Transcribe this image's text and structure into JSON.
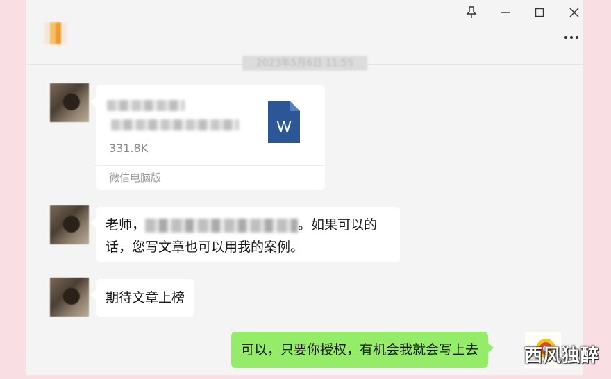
{
  "chat": {
    "timestamp": "2023年5月6日 11:55"
  },
  "messages": {
    "file": {
      "size": "331.8K",
      "source": "微信电脑版",
      "icon_letter": "W"
    },
    "msg2": {
      "prefix": "老师，",
      "suffix_line1": "。如果可以的",
      "line2": "话，您写文章也可以用我的案例。"
    },
    "msg3": {
      "text": "期待文章上榜"
    },
    "msg4": {
      "text": "可以，只要你授权，有机会我就会写上去"
    }
  },
  "watermark": {
    "text": "西风独醉"
  },
  "icons": [
    "pin-icon",
    "minimize-icon",
    "maximize-icon",
    "close-icon",
    "more-icon",
    "word-file-icon"
  ],
  "colors": {
    "window_bg": "#f4f4f4",
    "outside_bg": "#f9dfe3",
    "self_bubble": "#95ec69",
    "other_bubble": "#ffffff",
    "word_blue": "#2b5797"
  }
}
